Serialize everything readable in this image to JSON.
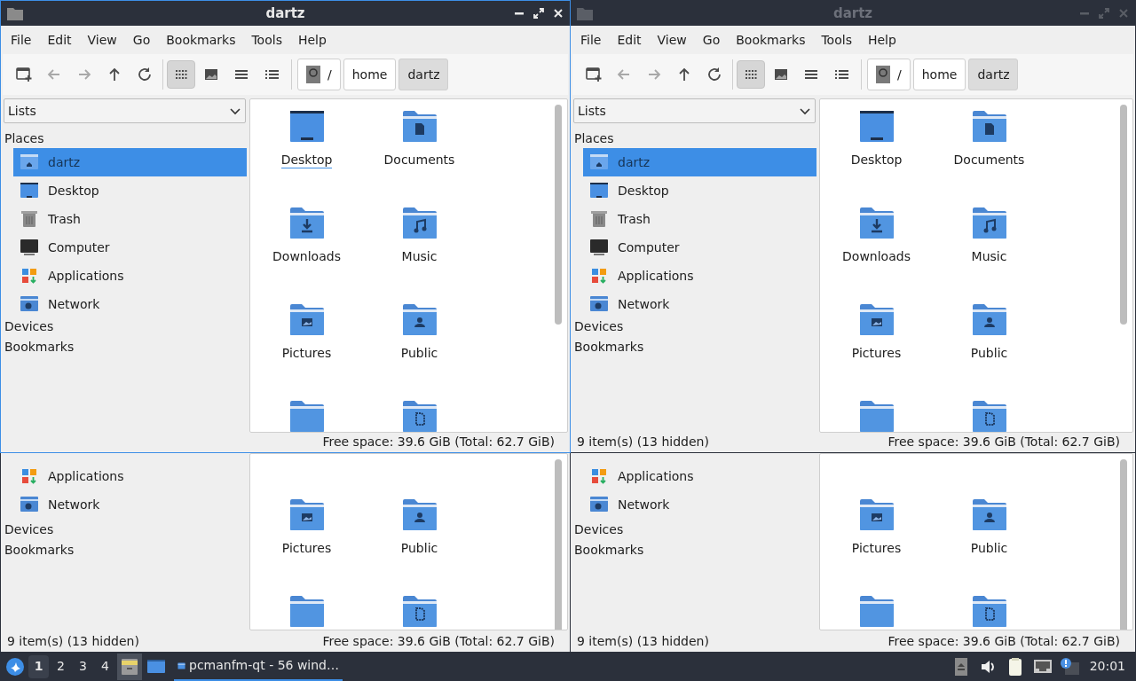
{
  "windows": [
    {
      "title": "dartz",
      "active": true,
      "menu": [
        "File",
        "Edit",
        "View",
        "Go",
        "Bookmarks",
        "Tools",
        "Help"
      ],
      "nav_buttons": [
        {
          "kind": "new-window",
          "disabled": false
        },
        {
          "kind": "back",
          "disabled": true
        },
        {
          "kind": "forward",
          "disabled": true
        },
        {
          "kind": "up",
          "disabled": false
        },
        {
          "kind": "reload",
          "disabled": false
        }
      ],
      "view_buttons": [
        {
          "kind": "icons",
          "selected": true
        },
        {
          "kind": "thumbnails",
          "selected": false
        },
        {
          "kind": "compact",
          "selected": false
        },
        {
          "kind": "details",
          "selected": false
        }
      ],
      "path": [
        {
          "label": "/",
          "kind": "root",
          "selected": false
        },
        {
          "label": "home",
          "kind": "dir",
          "selected": false
        },
        {
          "label": "dartz",
          "kind": "dir",
          "selected": true
        }
      ],
      "side_pane": "Lists",
      "sections": [
        {
          "label": "Places",
          "items": [
            {
              "label": "dartz",
              "kind": "home",
              "selected": true
            },
            {
              "label": "Desktop",
              "kind": "desktop",
              "selected": false
            },
            {
              "label": "Trash",
              "kind": "trash",
              "selected": false
            },
            {
              "label": "Computer",
              "kind": "computer",
              "selected": false
            },
            {
              "label": "Applications",
              "kind": "applications",
              "selected": false
            },
            {
              "label": "Network",
              "kind": "network",
              "selected": false
            }
          ]
        },
        {
          "label": "Devices"
        },
        {
          "label": "Bookmarks"
        }
      ],
      "files": [
        {
          "label": "Desktop",
          "kind": "desktop",
          "focused": true
        },
        {
          "label": "Documents",
          "kind": "documents",
          "focused": false
        },
        {
          "label": "Downloads",
          "kind": "downloads",
          "focused": false
        },
        {
          "label": "Music",
          "kind": "music",
          "focused": false
        },
        {
          "label": "Pictures",
          "kind": "pictures",
          "focused": false
        },
        {
          "label": "Public",
          "kind": "public",
          "focused": false
        },
        {
          "kind": "folder"
        },
        {
          "kind": "templates"
        }
      ],
      "status_right": "Free space: 39.6 GiB (Total: 62.7 GiB)"
    },
    {
      "title": "dartz",
      "active": false,
      "menu": [
        "File",
        "Edit",
        "View",
        "Go",
        "Bookmarks",
        "Tools",
        "Help"
      ],
      "nav_buttons": [
        {
          "kind": "new-window",
          "disabled": false
        },
        {
          "kind": "back",
          "disabled": true
        },
        {
          "kind": "forward",
          "disabled": true
        },
        {
          "kind": "up",
          "disabled": false
        },
        {
          "kind": "reload",
          "disabled": false
        }
      ],
      "view_buttons": [
        {
          "kind": "icons",
          "selected": true
        },
        {
          "kind": "thumbnails",
          "selected": false
        },
        {
          "kind": "compact",
          "selected": false
        },
        {
          "kind": "details",
          "selected": false
        }
      ],
      "path": [
        {
          "label": "/",
          "kind": "root",
          "selected": false
        },
        {
          "label": "home",
          "kind": "dir",
          "selected": false
        },
        {
          "label": "dartz",
          "kind": "dir",
          "selected": true
        }
      ],
      "side_pane": "Lists",
      "sections": [
        {
          "label": "Places",
          "items": [
            {
              "label": "dartz",
              "kind": "home",
              "selected": true
            },
            {
              "label": "Desktop",
              "kind": "desktop",
              "selected": false
            },
            {
              "label": "Trash",
              "kind": "trash",
              "selected": false
            },
            {
              "label": "Computer",
              "kind": "computer",
              "selected": false
            },
            {
              "label": "Applications",
              "kind": "applications",
              "selected": false
            },
            {
              "label": "Network",
              "kind": "network",
              "selected": false
            }
          ]
        },
        {
          "label": "Devices"
        },
        {
          "label": "Bookmarks"
        }
      ],
      "files": [
        {
          "label": "Desktop",
          "kind": "desktop",
          "focused": false
        },
        {
          "label": "Documents",
          "kind": "documents",
          "focused": false
        },
        {
          "label": "Downloads",
          "kind": "downloads",
          "focused": false
        },
        {
          "label": "Music",
          "kind": "music",
          "focused": false
        },
        {
          "label": "Pictures",
          "kind": "pictures",
          "focused": false
        },
        {
          "label": "Public",
          "kind": "public",
          "focused": false
        },
        {
          "kind": "folder"
        },
        {
          "kind": "templates"
        }
      ],
      "status_left": "9 item(s) (13 hidden)",
      "status_right": "Free space: 39.6 GiB (Total: 62.7 GiB)"
    }
  ],
  "background_windows": [
    {
      "places": [
        {
          "label": "Applications",
          "kind": "applications"
        },
        {
          "label": "Network",
          "kind": "network"
        }
      ],
      "sections": [
        "Devices",
        "Bookmarks"
      ],
      "files": [
        {
          "label": "Pictures",
          "kind": "pictures"
        },
        {
          "label": "Public",
          "kind": "public"
        },
        {
          "kind": "folder"
        },
        {
          "kind": "templates"
        }
      ],
      "status_left": "9 item(s) (13 hidden)",
      "status_right": "Free space: 39.6 GiB (Total: 62.7 GiB)"
    },
    {
      "places": [
        {
          "label": "Applications",
          "kind": "applications"
        },
        {
          "label": "Network",
          "kind": "network"
        }
      ],
      "sections": [
        "Devices",
        "Bookmarks"
      ],
      "files": [
        {
          "label": "Pictures",
          "kind": "pictures"
        },
        {
          "label": "Public",
          "kind": "public"
        },
        {
          "kind": "folder"
        },
        {
          "kind": "templates"
        }
      ],
      "status_left": "9 item(s) (13 hidden)",
      "status_right": "Free space: 39.6 GiB (Total: 62.7 GiB)"
    }
  ],
  "taskbar": {
    "workspaces": [
      {
        "label": "1",
        "selected": true
      },
      {
        "label": "2",
        "selected": false
      },
      {
        "label": "3",
        "selected": false
      },
      {
        "label": "4",
        "selected": false
      }
    ],
    "launchers": [
      {
        "kind": "file-manager",
        "selected": true
      },
      {
        "kind": "desktop",
        "selected": false
      }
    ],
    "tasks": [
      {
        "label": "pcmanfm-qt - 56 wind…",
        "active": true
      }
    ],
    "tray": [
      {
        "kind": "eject"
      },
      {
        "kind": "volume"
      },
      {
        "kind": "clipboard"
      },
      {
        "kind": "network"
      },
      {
        "kind": "update"
      }
    ],
    "clock": "20:01"
  }
}
